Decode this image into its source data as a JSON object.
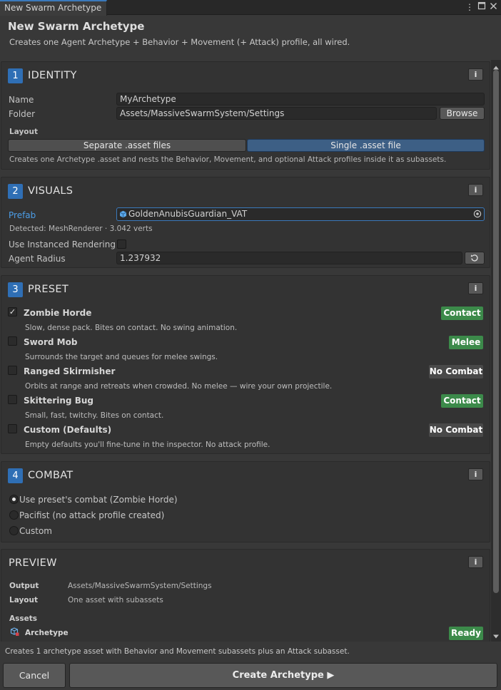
{
  "window": {
    "tab_title": "New Swarm Archetype",
    "controls": [
      "kebab-menu",
      "maximize",
      "close"
    ]
  },
  "header": {
    "title": "New Swarm Archetype",
    "subtitle": "Creates one Agent Archetype + Behavior + Movement (+ Attack) profile, all wired."
  },
  "identity": {
    "number": "1",
    "title": "IDENTITY",
    "info": "i",
    "name_label": "Name",
    "name_value": "MyArchetype",
    "folder_label": "Folder",
    "folder_value": "Assets/MassiveSwarmSystem/Settings",
    "browse_label": "Browse",
    "layout_label": "Layout",
    "layout_options": [
      "Separate .asset files",
      "Single .asset file"
    ],
    "layout_selected": "Single .asset file",
    "layout_help": "Creates one Archetype .asset and nests the Behavior, Movement, and optional Attack profiles inside it as subassets."
  },
  "visuals": {
    "number": "2",
    "title": "VISUALS",
    "info": "i",
    "prefab_label": "Prefab",
    "prefab_value": "GoldenAnubisGuardian_VAT",
    "detected": "Detected: MeshRenderer · 3.042 verts",
    "instanced_label": "Use Instanced Rendering",
    "instanced_checked": false,
    "radius_label": "Agent Radius",
    "radius_value": "1.237932"
  },
  "preset": {
    "number": "3",
    "title": "PRESET",
    "info": "i",
    "items": [
      {
        "name": "Zombie Horde",
        "desc": "Slow, dense pack. Bites on contact. No swing animation.",
        "badge": "Contact",
        "badge_color": "#3c8a4a",
        "checked": true
      },
      {
        "name": "Sword Mob",
        "desc": "Surrounds the target and queues for melee swings.",
        "badge": "Melee",
        "badge_color": "#3c8a4a",
        "checked": false
      },
      {
        "name": "Ranged Skirmisher",
        "desc": "Orbits at range and retreats when crowded. No melee — wire your own projectile.",
        "badge": "No Combat",
        "badge_color": "#494949",
        "checked": false
      },
      {
        "name": "Skittering Bug",
        "desc": "Small, fast, twitchy. Bites on contact.",
        "badge": "Contact",
        "badge_color": "#3c8a4a",
        "checked": false
      },
      {
        "name": "Custom (Defaults)",
        "desc": "Empty defaults you'll fine-tune in the inspector. No attack profile.",
        "badge": "No Combat",
        "badge_color": "#494949",
        "checked": false
      }
    ]
  },
  "combat": {
    "number": "4",
    "title": "COMBAT",
    "info": "i",
    "options": [
      {
        "label": "Use preset's combat (Zombie Horde)",
        "selected": true
      },
      {
        "label": "Pacifist (no attack profile created)",
        "selected": false
      },
      {
        "label": "Custom",
        "selected": false
      }
    ]
  },
  "preview": {
    "title": "PREVIEW",
    "info": "i",
    "output_label": "Output",
    "output_value": "Assets/MassiveSwarmSystem/Settings",
    "layout_label": "Layout",
    "layout_value": "One asset with subassets",
    "assets_label": "Assets",
    "asset_name": "Archetype",
    "asset_status": "Ready"
  },
  "footer": {
    "note": "Creates 1 archetype asset with Behavior and Movement subassets plus an Attack subasset.",
    "cancel_label": "Cancel",
    "create_label": "Create Archetype ▶"
  },
  "colors": {
    "accent_blue": "#2f6fb5",
    "badge_green": "#3c8a4a",
    "selected_layout": "#3d5f85",
    "prefab_link": "#4c9ee8"
  }
}
